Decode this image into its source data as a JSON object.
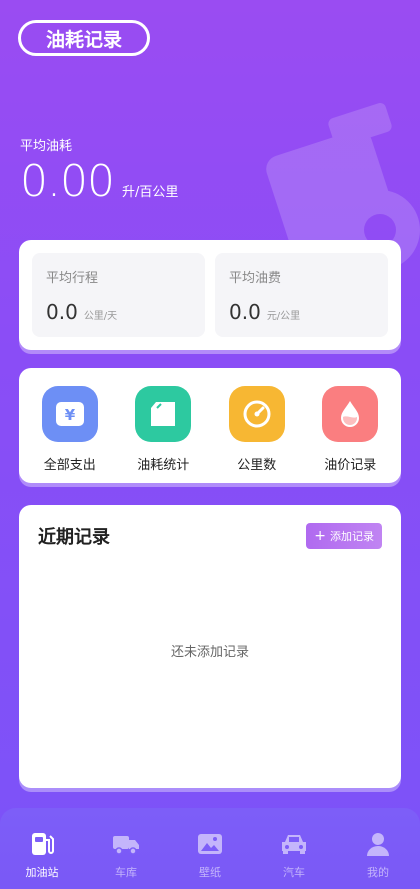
{
  "header": {
    "title": "油耗记录"
  },
  "summary": {
    "label": "平均油耗",
    "value": "0.00",
    "unit": "升/百公里"
  },
  "stats": [
    {
      "title": "平均行程",
      "value": "0.0",
      "unit": "公里/天"
    },
    {
      "title": "平均油费",
      "value": "0.0",
      "unit": "元/公里"
    }
  ],
  "menu": [
    {
      "label": "全部支出",
      "icon": "yen-wallet-icon",
      "color": "#6d8ff5"
    },
    {
      "label": "油耗统计",
      "icon": "fuel-can-icon",
      "color": "#2dc9a0"
    },
    {
      "label": "公里数",
      "icon": "speedometer-icon",
      "color": "#f7b733"
    },
    {
      "label": "油价记录",
      "icon": "oil-drop-icon",
      "color": "#fa7e80"
    }
  ],
  "records": {
    "title": "近期记录",
    "add_label": "添加记录",
    "empty_text": "还未添加记录"
  },
  "tabs": [
    {
      "label": "加油站",
      "icon": "gas-station-icon",
      "active": true
    },
    {
      "label": "车库",
      "icon": "truck-icon",
      "active": false
    },
    {
      "label": "壁纸",
      "icon": "picture-icon",
      "active": false
    },
    {
      "label": "汽车",
      "icon": "car-icon",
      "active": false
    },
    {
      "label": "我的",
      "icon": "user-icon",
      "active": false
    }
  ]
}
